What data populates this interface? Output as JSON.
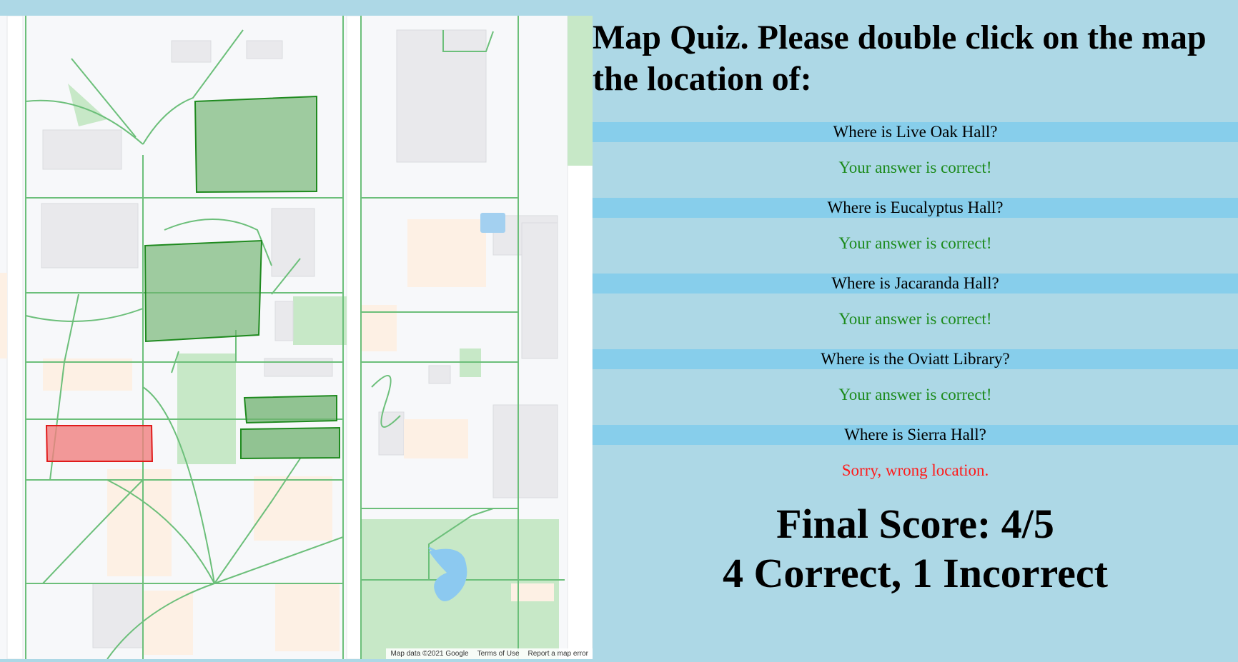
{
  "map": {
    "footer": {
      "attribution": "Map data ©2021 Google",
      "terms": "Terms of Use",
      "report": "Report a map error"
    },
    "highlight_colors": {
      "correct_fill": "#6fb26f",
      "correct_stroke": "#1f8a1f",
      "wrong_fill": "#f08080",
      "wrong_stroke": "#e01b1b"
    }
  },
  "quiz": {
    "heading": "Map Quiz. Please double click on the map the location of:",
    "items": [
      {
        "question": "Where is Live Oak Hall?",
        "feedback": "Your answer is correct!",
        "correct": true
      },
      {
        "question": "Where is Eucalyptus Hall?",
        "feedback": "Your answer is correct!",
        "correct": true
      },
      {
        "question": "Where is Jacaranda Hall?",
        "feedback": "Your answer is correct!",
        "correct": true
      },
      {
        "question": "Where is the Oviatt Library?",
        "feedback": "Your answer is correct!",
        "correct": true
      },
      {
        "question": "Where is Sierra Hall?",
        "feedback": "Sorry, wrong location.",
        "correct": false
      }
    ],
    "final_score": "Final Score: 4/5",
    "summary": "4 Correct, 1 Incorrect"
  }
}
